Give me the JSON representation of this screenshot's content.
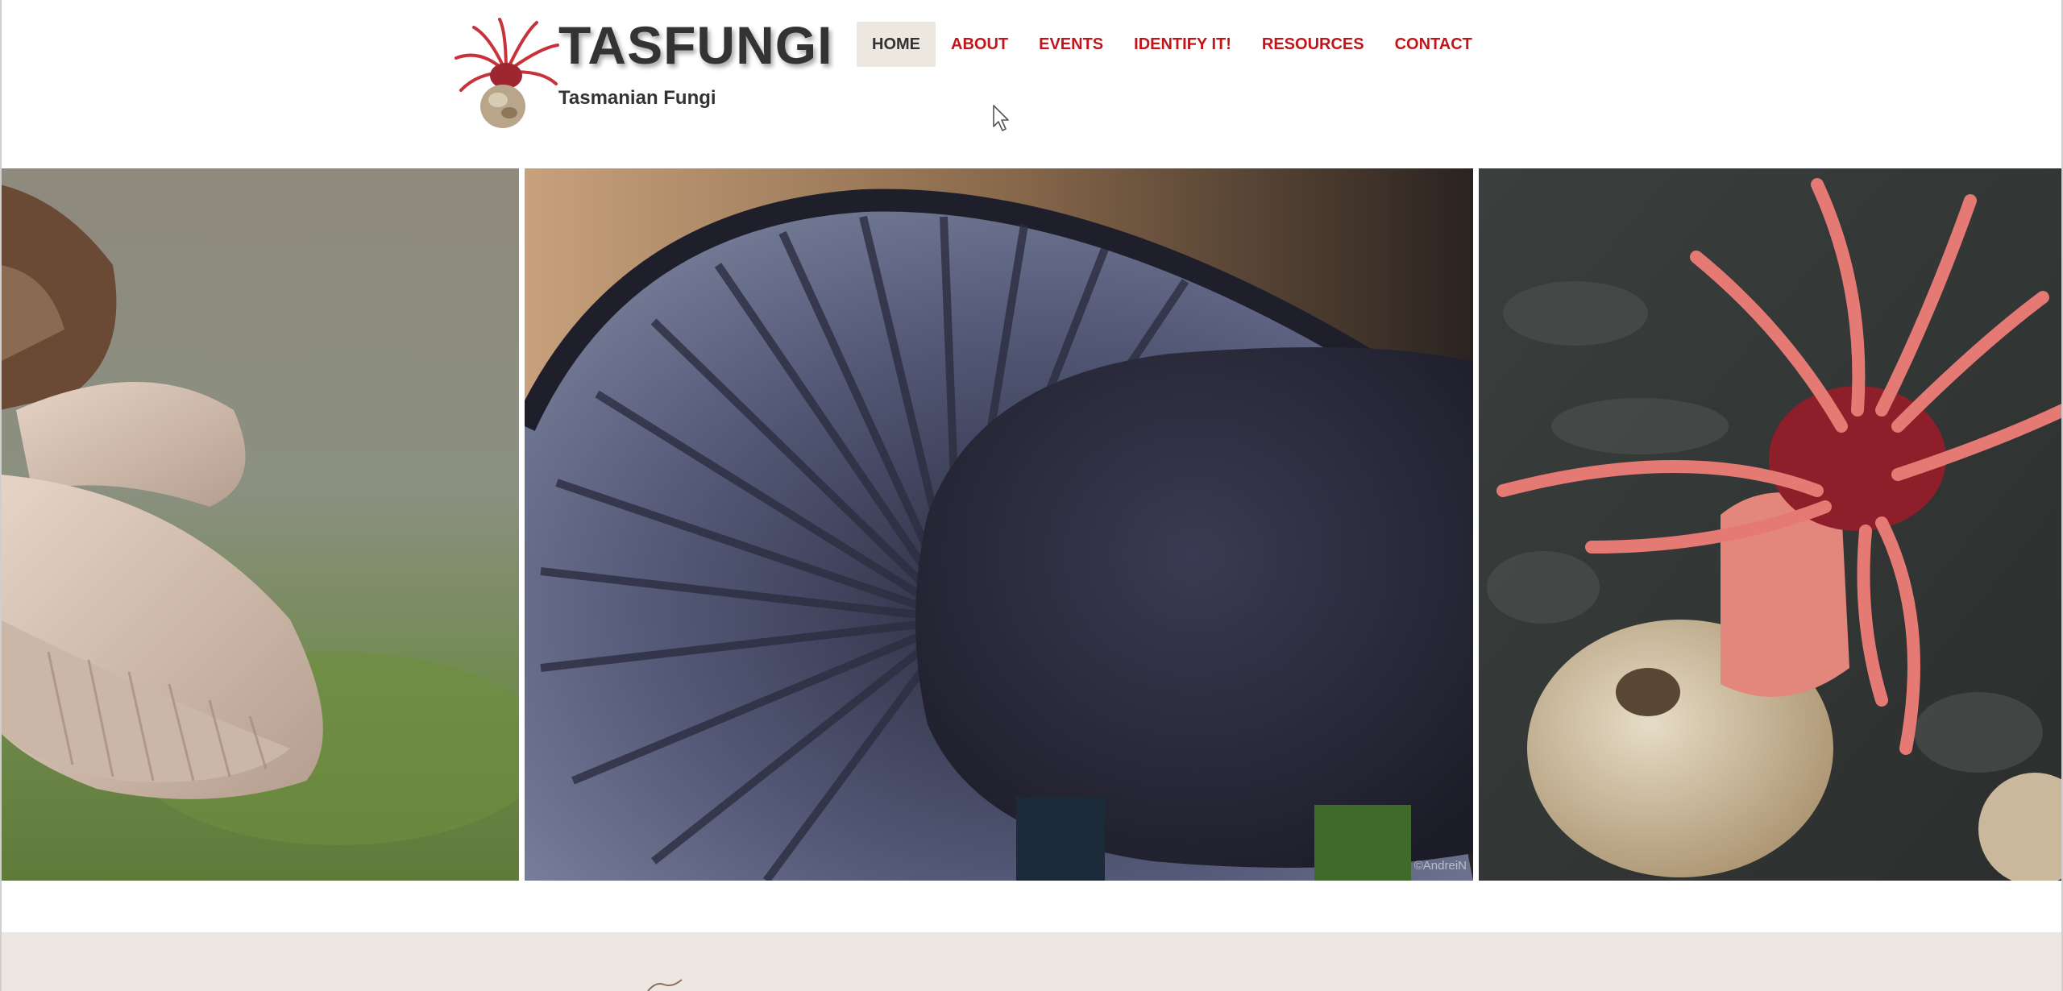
{
  "site": {
    "title": "TASFUNGI",
    "subtitle": "Tasmanian Fungi"
  },
  "nav": {
    "items": [
      {
        "label": "HOME",
        "active": true
      },
      {
        "label": "ABOUT",
        "active": false
      },
      {
        "label": "EVENTS",
        "active": false
      },
      {
        "label": "IDENTIFY IT!",
        "active": false
      },
      {
        "label": "RESOURCES",
        "active": false
      },
      {
        "label": "CONTACT",
        "active": false
      }
    ]
  },
  "slider": {
    "watermark": "©AndreiN"
  },
  "icons": {
    "logo": "anemone-stinkhorn-logo",
    "cursor": "mouse-pointer"
  },
  "colors": {
    "accent": "#c0161b",
    "text": "#333333",
    "nav_active_bg": "#ece7df",
    "footer_bg": "#ece7e1"
  }
}
